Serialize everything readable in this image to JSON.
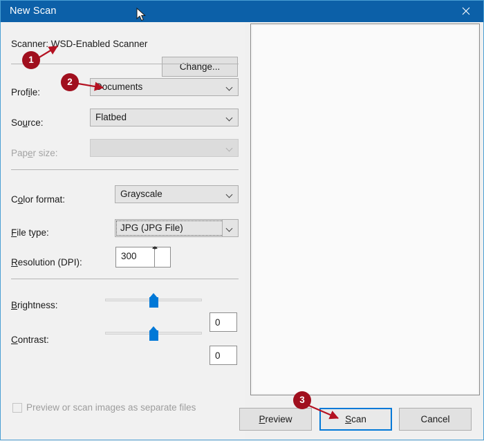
{
  "window": {
    "title": "New Scan",
    "close_icon": "close-icon",
    "titlebar_color": "#0c60a8"
  },
  "scanner": {
    "label": "Scanner: WSD-Enabled Scanner",
    "change_button": "Change..."
  },
  "fields": {
    "profile": {
      "label": "Profile:",
      "value": "Documents"
    },
    "source": {
      "label": "Source:",
      "value": "Flatbed"
    },
    "paper_size": {
      "label": "Paper size:",
      "value": "",
      "disabled": true
    },
    "color_format": {
      "label": "Color format:",
      "value": "Grayscale"
    },
    "file_type": {
      "label": "File type:",
      "value": "JPG (JPG File)",
      "focused": true
    },
    "resolution": {
      "label": "Resolution (DPI):",
      "value": "300"
    }
  },
  "sliders": {
    "brightness": {
      "label": "Brightness:",
      "value": "0",
      "min": -100,
      "max": 100,
      "position_pct": 50
    },
    "contrast": {
      "label": "Contrast:",
      "value": "0",
      "min": -100,
      "max": 100,
      "position_pct": 50
    }
  },
  "options": {
    "preview_separate_files": {
      "label": "Preview or scan images as separate files",
      "checked": false,
      "disabled": true
    }
  },
  "preview": {
    "content": ""
  },
  "buttons": {
    "preview": "Preview",
    "scan": "Scan",
    "cancel": "Cancel"
  },
  "annotations": {
    "badge1": "1",
    "badge2": "2",
    "badge3": "3",
    "color": "#a00f1e"
  }
}
